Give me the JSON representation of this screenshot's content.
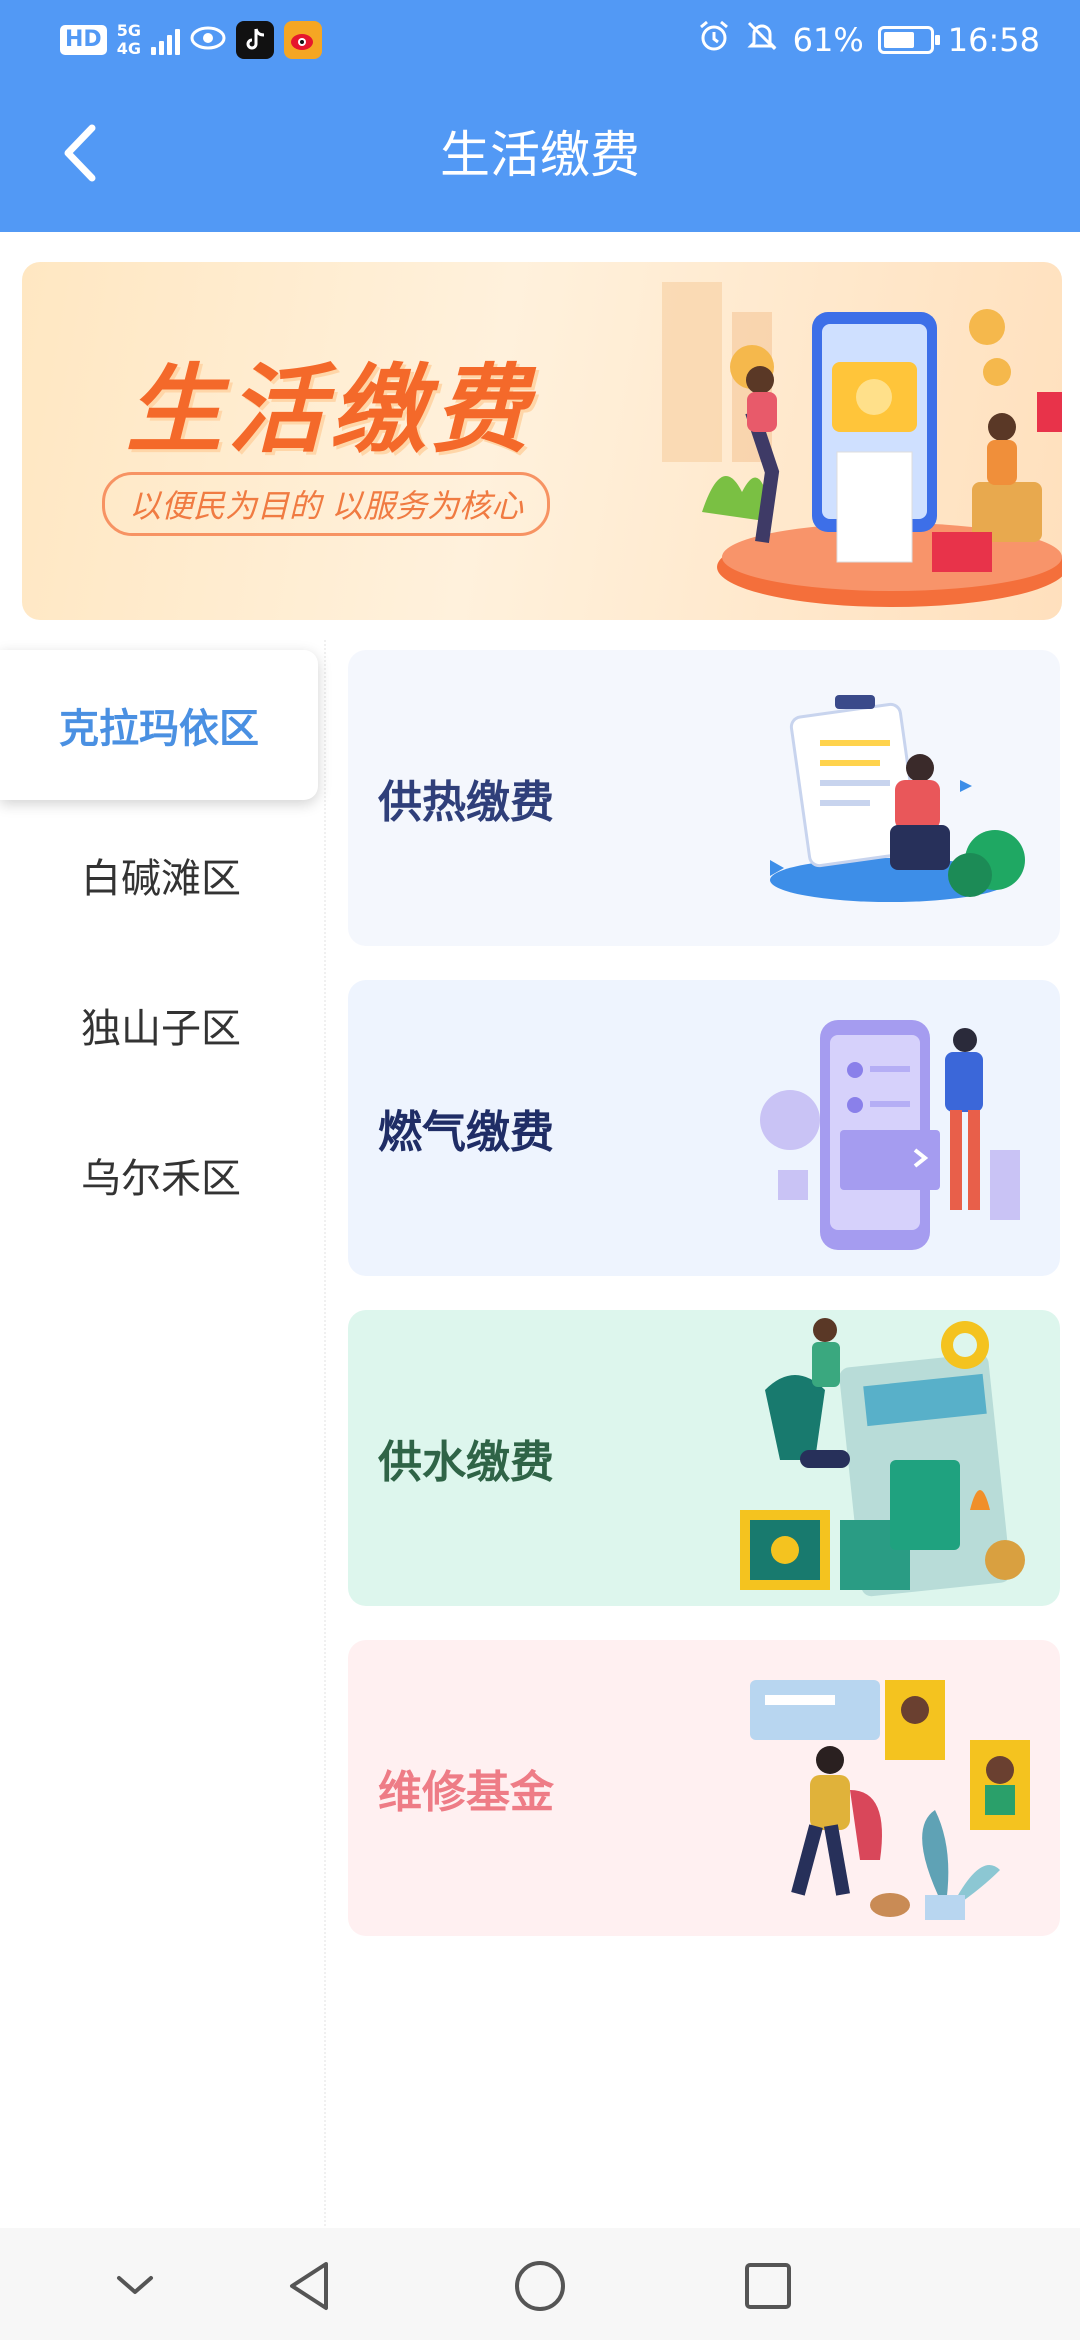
{
  "status_bar": {
    "hd": "HD",
    "net_top": "5G",
    "net_bottom": "4G",
    "battery": "61%",
    "time": "16:58"
  },
  "header": {
    "title": "生活缴费"
  },
  "banner": {
    "title": "生活缴费",
    "slogan": "以便民为目的 以服务为核心"
  },
  "sidebar": {
    "items": [
      {
        "label": "克拉玛依区",
        "active": true
      },
      {
        "label": "白碱滩区",
        "active": false
      },
      {
        "label": "独山子区",
        "active": false
      },
      {
        "label": "乌尔禾区",
        "active": false
      }
    ]
  },
  "cards": [
    {
      "label": "供热缴费",
      "color": "#2f3f7a",
      "bg": "#f4f7fd"
    },
    {
      "label": "燃气缴费",
      "color": "#1f2d66",
      "bg": "#eef4fe"
    },
    {
      "label": "供水缴费",
      "color": "#2f6447",
      "bg": "#ddf6ed"
    },
    {
      "label": "维修基金",
      "color": "#ee7c86",
      "bg": "#fff0f1"
    }
  ],
  "colors": {
    "header_bg": "#5299f5",
    "active_side": "#4a90e2"
  }
}
